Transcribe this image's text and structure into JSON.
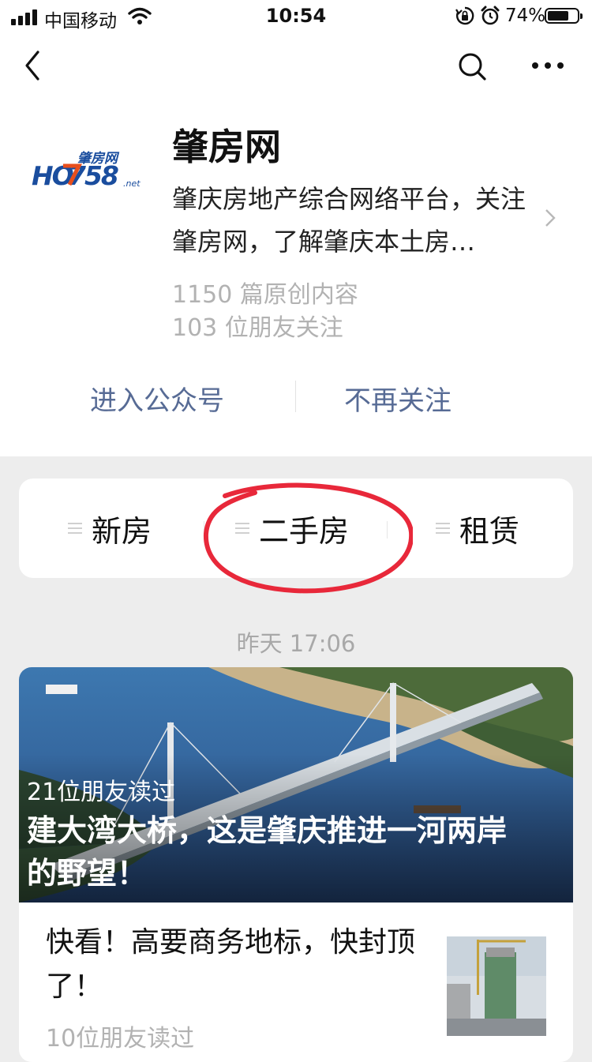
{
  "status_bar": {
    "carrier": "中国移动",
    "time": "10:54",
    "battery_percent": "74%",
    "battery_level": 0.74,
    "icons": [
      "signal-icon",
      "wifi-icon",
      "rotation-lock-icon",
      "alarm-icon",
      "battery-icon"
    ]
  },
  "nav": {
    "icons": [
      "back-icon",
      "search-icon",
      "more-icon"
    ]
  },
  "profile": {
    "logo_text": "肇房网 HO758 .net",
    "name": "肇房网",
    "description": "肇庆房地产综合网络平台，关注肇房网，了解肇庆本土房…",
    "original_count": "1150 篇原创内容",
    "followers": "103 位朋友关注"
  },
  "actions": {
    "enter": "进入公众号",
    "unfollow": "不再关注"
  },
  "menu": {
    "items": [
      {
        "label": "新房"
      },
      {
        "label": "二手房"
      },
      {
        "label": "租赁"
      }
    ]
  },
  "feed": {
    "date": "昨天 17:06",
    "articles": [
      {
        "readers": "21位朋友读过",
        "title": "建大湾大桥，这是肇庆推进一河两岸的野望！"
      },
      {
        "readers": "10位朋友读过",
        "title": "快看！高要商务地标，快封顶了！"
      }
    ]
  },
  "colors": {
    "link": "#576b95",
    "annotation": "#e8283a",
    "muted": "#b2b2b2"
  }
}
